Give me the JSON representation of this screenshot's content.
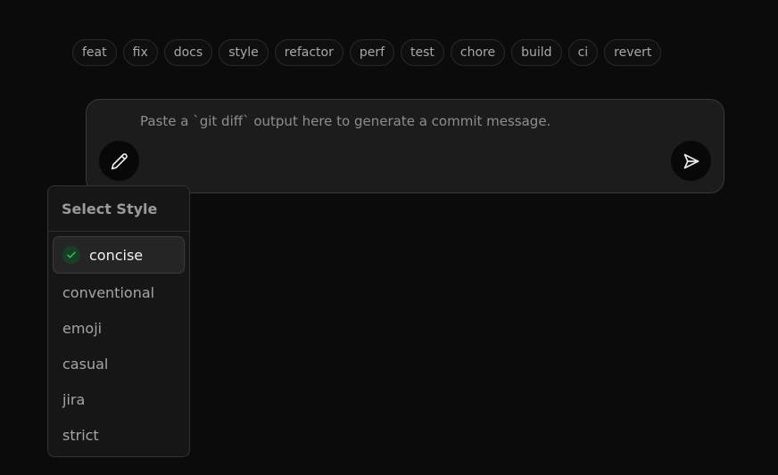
{
  "tags": [
    "feat",
    "fix",
    "docs",
    "style",
    "refactor",
    "perf",
    "test",
    "chore",
    "build",
    "ci",
    "revert"
  ],
  "composer": {
    "placeholder": "Paste a `git diff` output here to generate a commit message.",
    "value": ""
  },
  "style_menu": {
    "title": "Select Style",
    "selected": "concise",
    "options": [
      "concise",
      "conventional",
      "emoji",
      "casual",
      "jira",
      "strict"
    ]
  },
  "icons": {
    "style_button": "pencil-icon",
    "send_button": "send-icon",
    "selected_marker": "check-circle-icon"
  },
  "colors": {
    "background": "#0b0b0b",
    "composer_bg": "#1c1c1c",
    "check_bg": "#163f24",
    "check_fg": "#3bbd62"
  }
}
